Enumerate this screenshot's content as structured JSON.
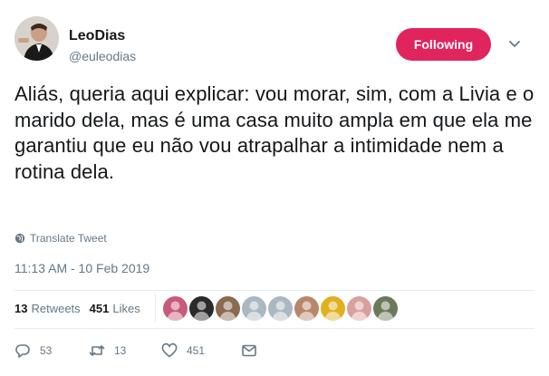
{
  "author": {
    "name": "LeoDias",
    "handle": "@euleodias"
  },
  "follow_button": {
    "label": "Following"
  },
  "tweet": {
    "text": "Aliás, queria aqui explicar: vou morar, sim, com a Livia e o marido dela, mas é uma casa muito ampla em que ela me garantiu que eu não vou atrapalhar a intimidade nem a rotina dela.",
    "translate_label": "Translate Tweet",
    "timestamp": "11:13 AM - 10 Feb 2019"
  },
  "stats": {
    "retweets_count": "13",
    "retweets_label": "Retweets",
    "likes_count": "451",
    "likes_label": "Likes"
  },
  "liker_avatars": [
    "#c85a7a",
    "#2a2a2a",
    "#8a6a50",
    "#aab8c2",
    "#aab8c2",
    "#b8866a",
    "#e0b020",
    "#d9a0a0",
    "#6a7a5a"
  ],
  "actions": {
    "replies": "53",
    "retweets": "13",
    "likes": "451"
  },
  "colors": {
    "accent": "#e0245e",
    "secondary_text": "#657786",
    "divider": "#e6ecf0"
  }
}
